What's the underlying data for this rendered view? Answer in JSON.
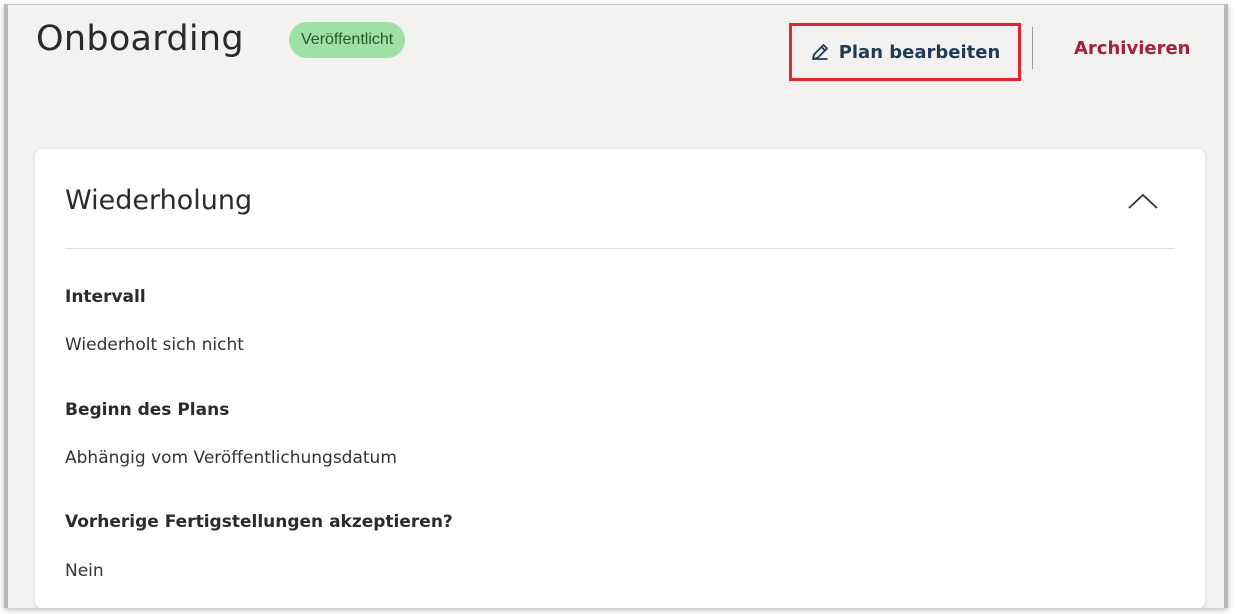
{
  "header": {
    "title": "Onboarding",
    "status": "Veröffentlicht",
    "edit_label": "Plan bearbeiten",
    "archive_label": "Archivieren"
  },
  "icons": {
    "edit": "pencil-edit-icon",
    "collapse": "chevron-up-icon"
  },
  "colors": {
    "badge_bg": "#9ee0a6",
    "badge_text": "#1d5b27",
    "highlight_border": "#e0262e",
    "archive_text": "#a3223a",
    "edit_text": "#1f3b57"
  },
  "section": {
    "title": "Wiederholung",
    "fields": [
      {
        "label": "Intervall",
        "value": "Wiederholt sich nicht"
      },
      {
        "label": "Beginn des Plans",
        "value": "Abhängig vom Veröffentlichungsdatum"
      },
      {
        "label": "Vorherige Fertigstellungen akzeptieren?",
        "value": "Nein"
      }
    ]
  }
}
